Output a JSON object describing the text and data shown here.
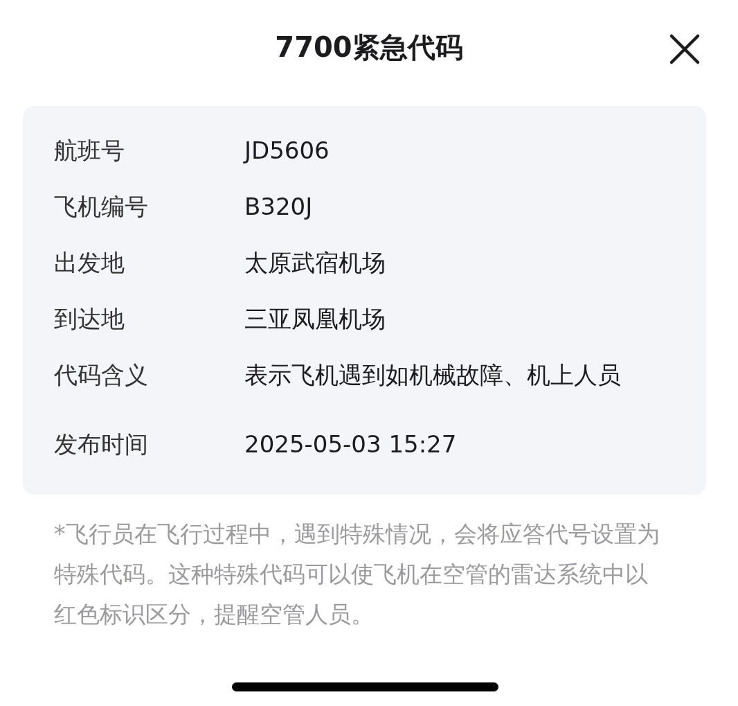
{
  "header": {
    "title": "7700紧急代码"
  },
  "details": [
    {
      "label": "航班号",
      "value": "JD5606"
    },
    {
      "label": "飞机编号",
      "value": "B320J"
    },
    {
      "label": "出发地",
      "value": "太原武宿机场"
    },
    {
      "label": "到达地",
      "value": "三亚凤凰机场"
    },
    {
      "label": "代码含义",
      "value": "表示飞机遇到如机械故障、机上人员"
    },
    {
      "label": "发布时间",
      "value": "2025-05-03 15:27"
    }
  ],
  "note": "*飞行员在飞行过程中，遇到特殊情况，会将应答代号设置为特殊代码。这种特殊代码可以使飞机在空管的雷达系统中以红色标识区分，提醒空管人员。"
}
